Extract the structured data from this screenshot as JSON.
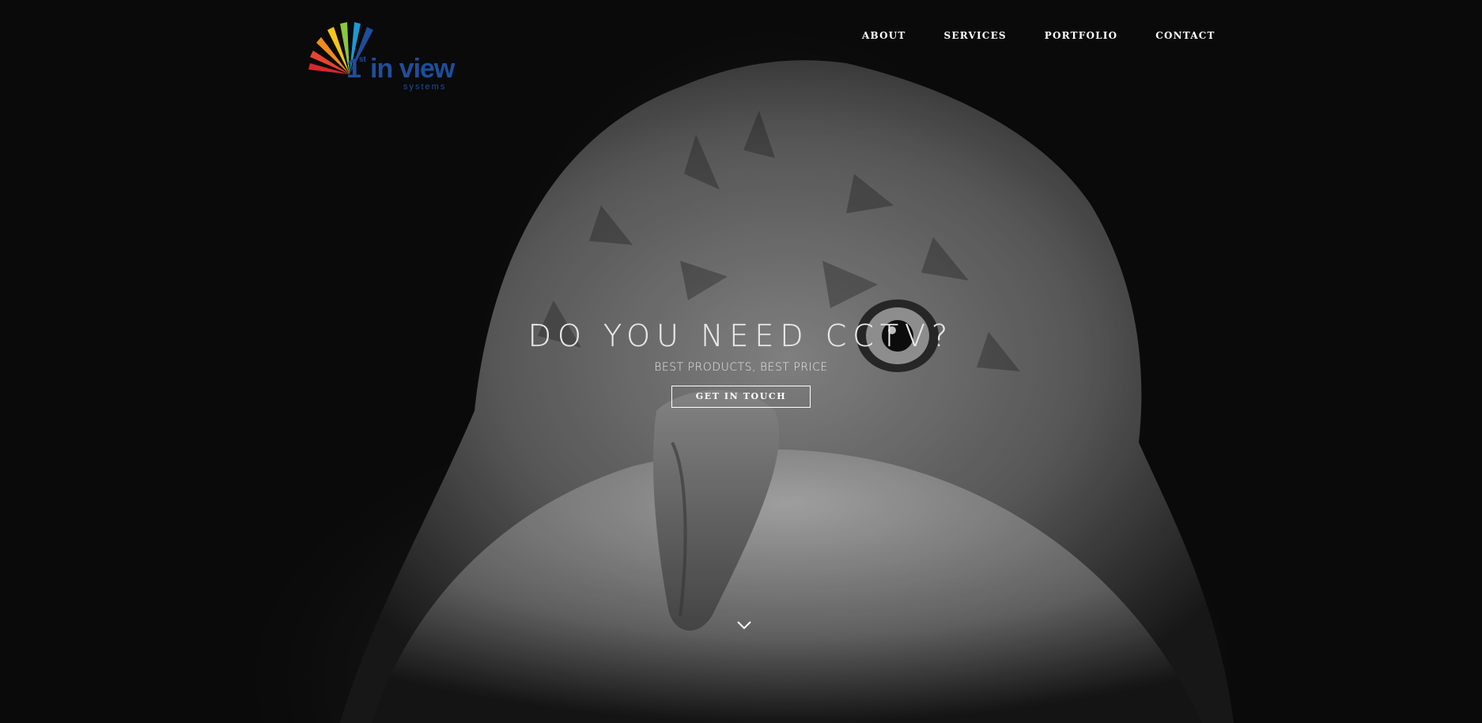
{
  "logo": {
    "text_main": "1st in view",
    "text_sup": "st",
    "text_sub": "systems",
    "colors": [
      "#d7262e",
      "#e8442c",
      "#f08b1d",
      "#f5c518",
      "#8cc63f",
      "#1a9ad6",
      "#1f4e9a"
    ]
  },
  "nav": {
    "items": [
      {
        "label": "ABOUT"
      },
      {
        "label": "SERVICES"
      },
      {
        "label": "PORTFOLIO"
      },
      {
        "label": "CONTACT"
      }
    ]
  },
  "hero": {
    "title": "DO YOU NEED CCTV?",
    "subtitle": "BEST PRODUCTS, BEST PRICE",
    "cta_label": "GET IN TOUCH",
    "scroll_icon": "chevron-down-icon"
  }
}
